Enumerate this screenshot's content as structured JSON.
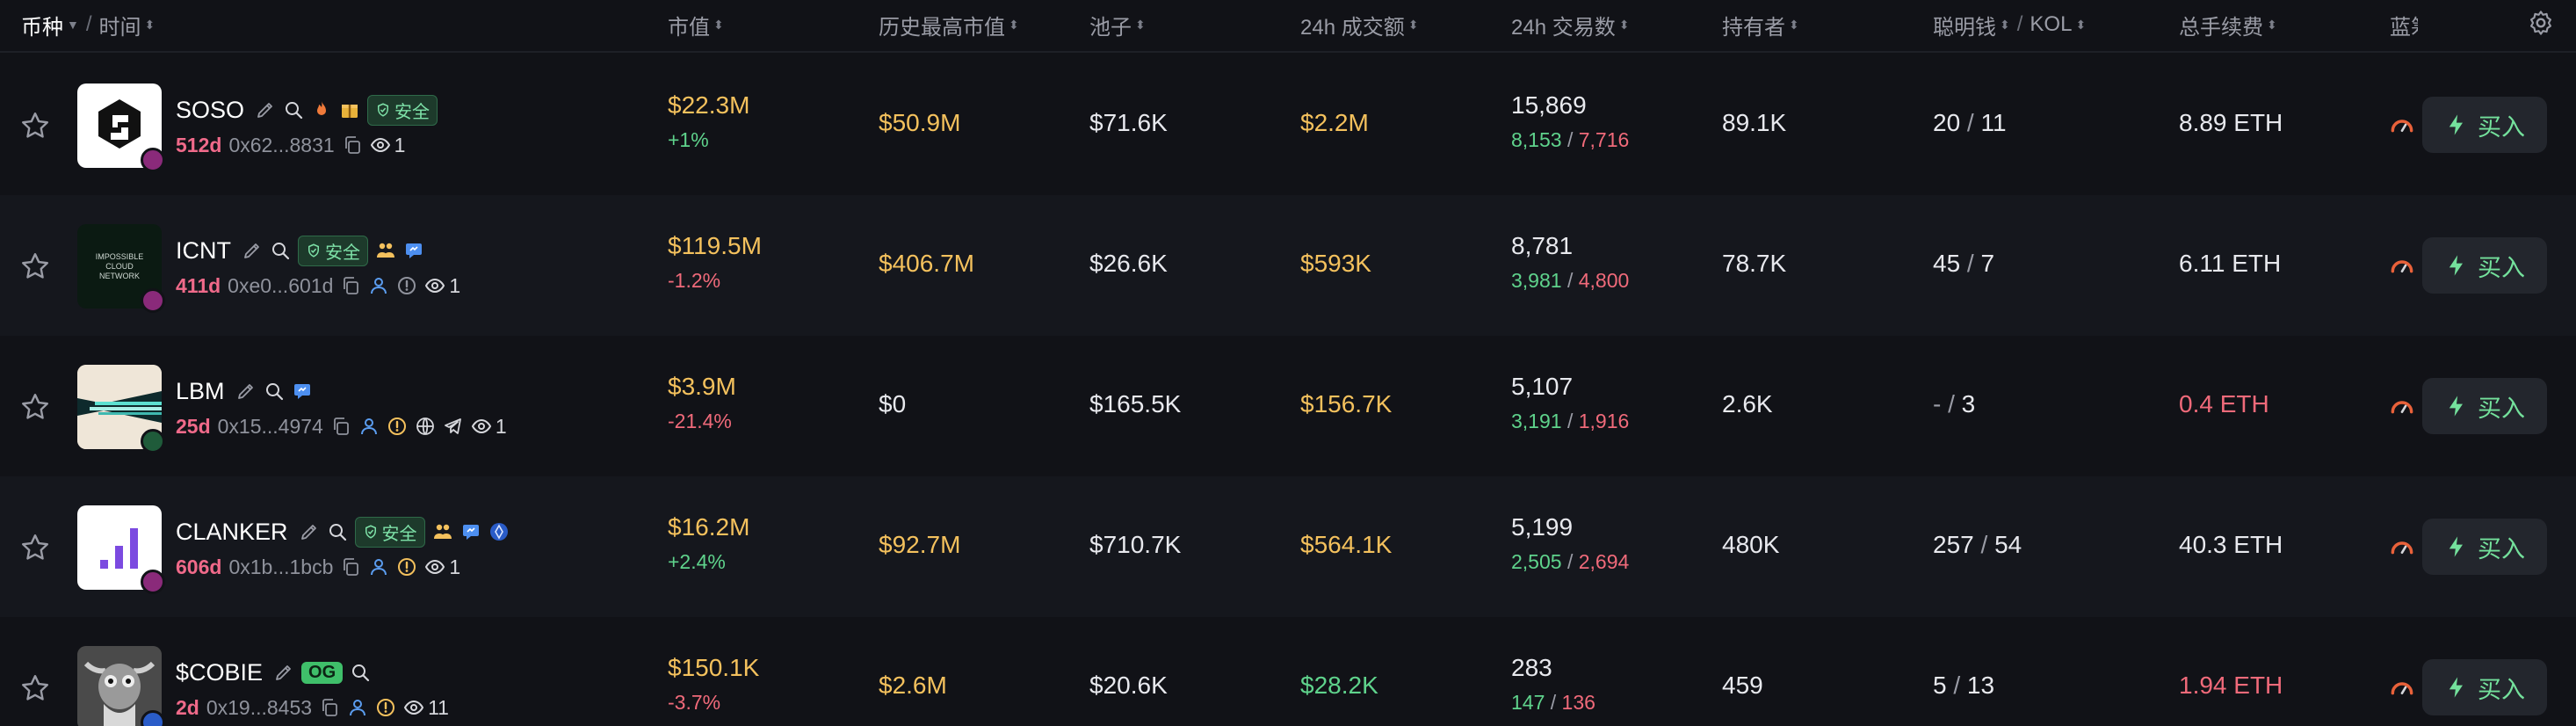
{
  "header": {
    "coin": "币种",
    "slash": "/",
    "time": "时间",
    "market_cap": "市值",
    "ath_market_cap": "历史最高市值",
    "pool": "池子",
    "volume_24h": "24h 成交额",
    "txns_24h": "24h 交易数",
    "holders": "持有者",
    "smart_money": "聪明钱",
    "kol": "KOL",
    "total_fees": "总手续费",
    "bluechip": "蓝筹",
    "sort_icon": "sort-arrows-icon",
    "gear_icon": "gear-icon"
  },
  "buy_label": "买入",
  "safe_label": "安全",
  "og_label": "OG",
  "colors": {
    "background": "#111217",
    "row_alt": "#15171d",
    "yellow": "#f4c15d",
    "green": "#5fd38c",
    "red": "#f06a7a",
    "age": "#f06a8a"
  },
  "rows": [
    {
      "name": "SOSO",
      "age": "512d",
      "address": "0x62...8831",
      "viewers": "1",
      "market_cap": "$22.3M",
      "change": "+1%",
      "ath": "$50.9M",
      "pool": "$71.6K",
      "volume": "$2.2M",
      "txns": "15,869",
      "buys": "8,153",
      "sells": "7,716",
      "holders": "89.1K",
      "smart": "20",
      "kol": "11",
      "fees": "8.89 ETH"
    },
    {
      "name": "ICNT",
      "age": "411d",
      "address": "0xe0...601d",
      "viewers": "1",
      "market_cap": "$119.5M",
      "change": "-1.2%",
      "ath": "$406.7M",
      "pool": "$26.6K",
      "volume": "$593K",
      "txns": "8,781",
      "buys": "3,981",
      "sells": "4,800",
      "holders": "78.7K",
      "smart": "45",
      "kol": "7",
      "fees": "6.11 ETH",
      "avatar_text": "IMPOSSIBLE CLOUD NETWORK"
    },
    {
      "name": "LBM",
      "age": "25d",
      "address": "0x15...4974",
      "viewers": "1",
      "market_cap": "$3.9M",
      "change": "-21.4%",
      "ath": "$0",
      "pool": "$165.5K",
      "volume": "$156.7K",
      "txns": "5,107",
      "buys": "3,191",
      "sells": "1,916",
      "holders": "2.6K",
      "smart": "-",
      "kol": "3",
      "fees": "0.4 ETH"
    },
    {
      "name": "CLANKER",
      "age": "606d",
      "address": "0x1b...1bcb",
      "viewers": "1",
      "market_cap": "$16.2M",
      "change": "+2.4%",
      "ath": "$92.7M",
      "pool": "$710.7K",
      "volume": "$564.1K",
      "txns": "5,199",
      "buys": "2,505",
      "sells": "2,694",
      "holders": "480K",
      "smart": "257",
      "kol": "54",
      "fees": "40.3 ETH"
    },
    {
      "name": "$COBIE",
      "age": "2d",
      "address": "0x19...8453",
      "viewers": "11",
      "market_cap": "$150.1K",
      "change": "-3.7%",
      "ath": "$2.6M",
      "pool": "$20.6K",
      "volume": "$28.2K",
      "txns": "283",
      "buys": "147",
      "sells": "136",
      "holders": "459",
      "smart": "5",
      "kol": "13",
      "fees": "1.94 ETH"
    }
  ]
}
